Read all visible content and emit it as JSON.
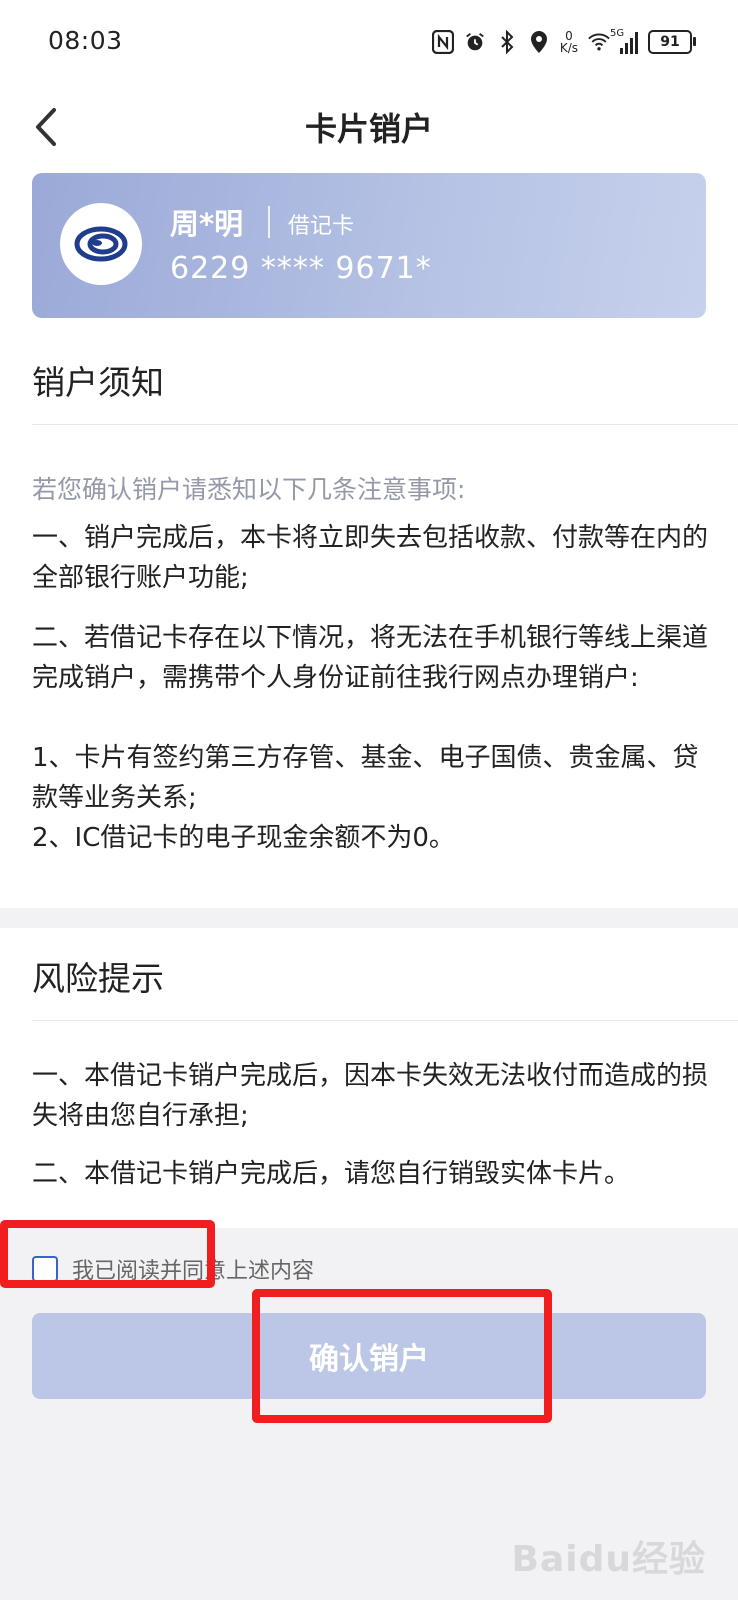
{
  "status_bar": {
    "time": "08:03",
    "net_speed_value": "0",
    "net_speed_unit": "K/s",
    "signal_label": "5G",
    "battery": "91",
    "icons": [
      "nfc-icon",
      "alarm-icon",
      "bluetooth-icon",
      "location-icon",
      "wifi-icon",
      "signal-icon",
      "battery-icon"
    ]
  },
  "header": {
    "title": "卡片销户"
  },
  "card": {
    "holder": "周*明",
    "type": "借记卡",
    "number": "6229 **** 9671*"
  },
  "notice": {
    "title": "销户须知",
    "intro": "若您确认销户请悉知以下几条注意事项:",
    "p1": "一、销户完成后，本卡将立即失去包括收款、付款等在内的全部银行账户功能;",
    "p2": "二、若借记卡存在以下情况，将无法在手机银行等线上渠道完成销户，需携带个人身份证前往我行网点办理销户:",
    "p2_item1": "1、卡片有签约第三方存管、基金、电子国债、贵金属、贷款等业务关系;",
    "p2_item2": "2、IC借记卡的电子现金余额不为0。"
  },
  "risk": {
    "title": "风险提示",
    "p1": "一、本借记卡销户完成后，因本卡失效无法收付而造成的损失将由您自行承担;",
    "p2": "二、本借记卡销户完成后，请您自行销毁实体卡片。"
  },
  "agreement": {
    "label": "我已阅读并同意上述内容",
    "checked": false
  },
  "confirm_button": {
    "label": "确认销户"
  },
  "watermark": "Baidu经验",
  "colors": {
    "accent": "#3a63c8",
    "button_disabled": "#bcc6e6",
    "card_gradient_start": "#9aa9d7",
    "annotation_red": "#f01e1e"
  }
}
